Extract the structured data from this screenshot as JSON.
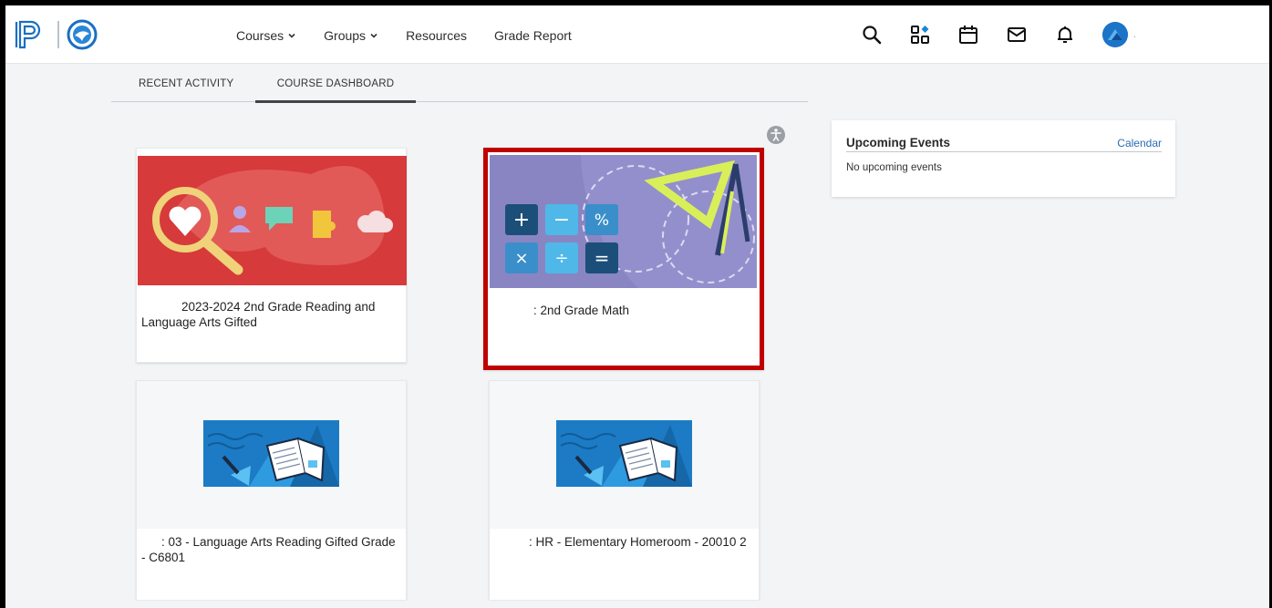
{
  "nav": {
    "items": [
      {
        "label": "Courses",
        "dropdown": true
      },
      {
        "label": "Groups",
        "dropdown": true
      },
      {
        "label": "Resources",
        "dropdown": false
      },
      {
        "label": "Grade Report",
        "dropdown": false
      }
    ]
  },
  "header_icons": [
    "search-icon",
    "apps-icon",
    "calendar-icon",
    "mail-icon",
    "bell-icon",
    "avatar"
  ],
  "avatar_suffix": ".",
  "tabs": [
    {
      "label": "RECENT ACTIVITY",
      "active": false
    },
    {
      "label": "COURSE DASHBOARD",
      "active": true
    }
  ],
  "courses": [
    {
      "title": "2023-2024 2nd Grade Reading and Language Arts Gifted",
      "image": "reading-illustration",
      "highlighted": false
    },
    {
      "title": ": 2nd Grade Math",
      "image": "math-illustration",
      "highlighted": true
    },
    {
      "title": ": 03 - Language Arts Reading Gifted Grade - C6801",
      "image": "book-illustration",
      "highlighted": false
    },
    {
      "title": ": HR - Elementary Homeroom - 20010 2",
      "image": "book-illustration",
      "highlighted": false
    }
  ],
  "events": {
    "title": "Upcoming Events",
    "link": "Calendar",
    "empty_text": "No upcoming events"
  },
  "colors": {
    "highlight_border": "#c00000",
    "link": "#2a6db3",
    "reading_bg": "#d63a3a",
    "math_bg": "#8a86c4",
    "book_bg": "#1c7bc4"
  }
}
